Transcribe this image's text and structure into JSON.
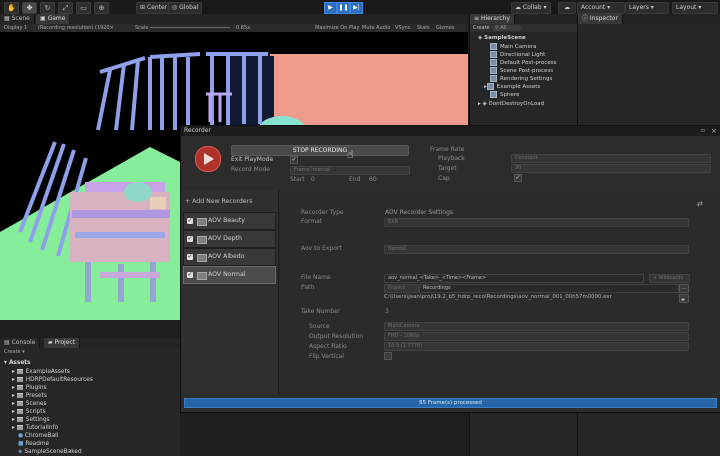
{
  "toolbar": {
    "tools": [
      "hand-icon",
      "move-icon",
      "rotate-icon",
      "scale-icon",
      "rect-icon",
      "transform-icon"
    ],
    "pivot_label": "Center",
    "space_label": "Global",
    "collab_label": "Collab",
    "account_label": "Account",
    "layers_label": "Layers",
    "layout_label": "Layout"
  },
  "tabs": {
    "scene": "Scene",
    "game": "Game",
    "hierarchy": "Hierarchy",
    "inspector": "Inspector",
    "console": "Console",
    "project": "Project"
  },
  "game_bar": {
    "display": "Display 1",
    "resolution": "(Recording resolution) (1920×",
    "scale_label": "Scale",
    "scale_value": "0.65x",
    "options": [
      "Maximize On Play",
      "Mute Audio",
      "VSync",
      "Stats",
      "Gizmos"
    ]
  },
  "hierarchy": {
    "create": "Create",
    "search": "All",
    "scene": "SampleScene",
    "items": [
      "Main Camera",
      "Directional Light",
      "Default Post-process",
      "Scene Post-process",
      "Rendering Settings",
      "Example Assets",
      "Sphere"
    ],
    "ddol": "DontDestroyOnLoad"
  },
  "project": {
    "create": "Create",
    "root": "Assets",
    "items": [
      "ExampleAssets",
      "HDRPDefaultResources",
      "Plugins",
      "Presets",
      "Scenes",
      "Scripts",
      "Settings",
      "TutorialInfo",
      "ChromeBall",
      "Readme",
      "SampleSceneBaked"
    ]
  },
  "recorder": {
    "title": "Recorder",
    "stop_label": "STOP RECORDING",
    "exit_playmode": "Exit PlayMode",
    "record_mode": "Record Mode",
    "record_mode_value": "Frame Interval",
    "start_label": "Start",
    "start_value": "0",
    "end_label": "End",
    "end_value": "60",
    "frame_rate": "Frame Rate",
    "playback": "Playback",
    "playback_value": "Constant",
    "target": "Target",
    "target_value": "30",
    "cap": "Cap",
    "add_new": "+ Add New Recorders",
    "recorders": [
      "AOV Beauty",
      "AOV Depth",
      "AOV Albedo",
      "AOV Normal"
    ],
    "settings": {
      "type_label": "Recorder Type",
      "type_value": "AOV Recorder Settings",
      "format_label": "Format",
      "format_value": "EXR",
      "aov_label": "Aov to Export",
      "aov_value": "Normal",
      "filename_label": "File Name",
      "filename_value": "aov_normal_<Take>_<Time><Frame>",
      "wildcards": "+ Wildcards",
      "path_label": "Path",
      "path_root": "Project",
      "path_sub": "Recordings",
      "full_path": "C:\\Users\\jean\\proj\\19.2_b5_hdrp_reco\\Recordings\\aov_normal_001_00h57m0000.exr",
      "take_label": "Take Number",
      "take_value": "3",
      "source_label": "Source",
      "source_value": "MainCamera",
      "res_label": "Output Resolution",
      "res_value": "FHD - 1080p",
      "aspect_label": "Aspect Ratio",
      "aspect_value": "16:9 (1.7778)",
      "flip_label": "Flip Vertical"
    },
    "status": "65 Frame(s) processed"
  }
}
